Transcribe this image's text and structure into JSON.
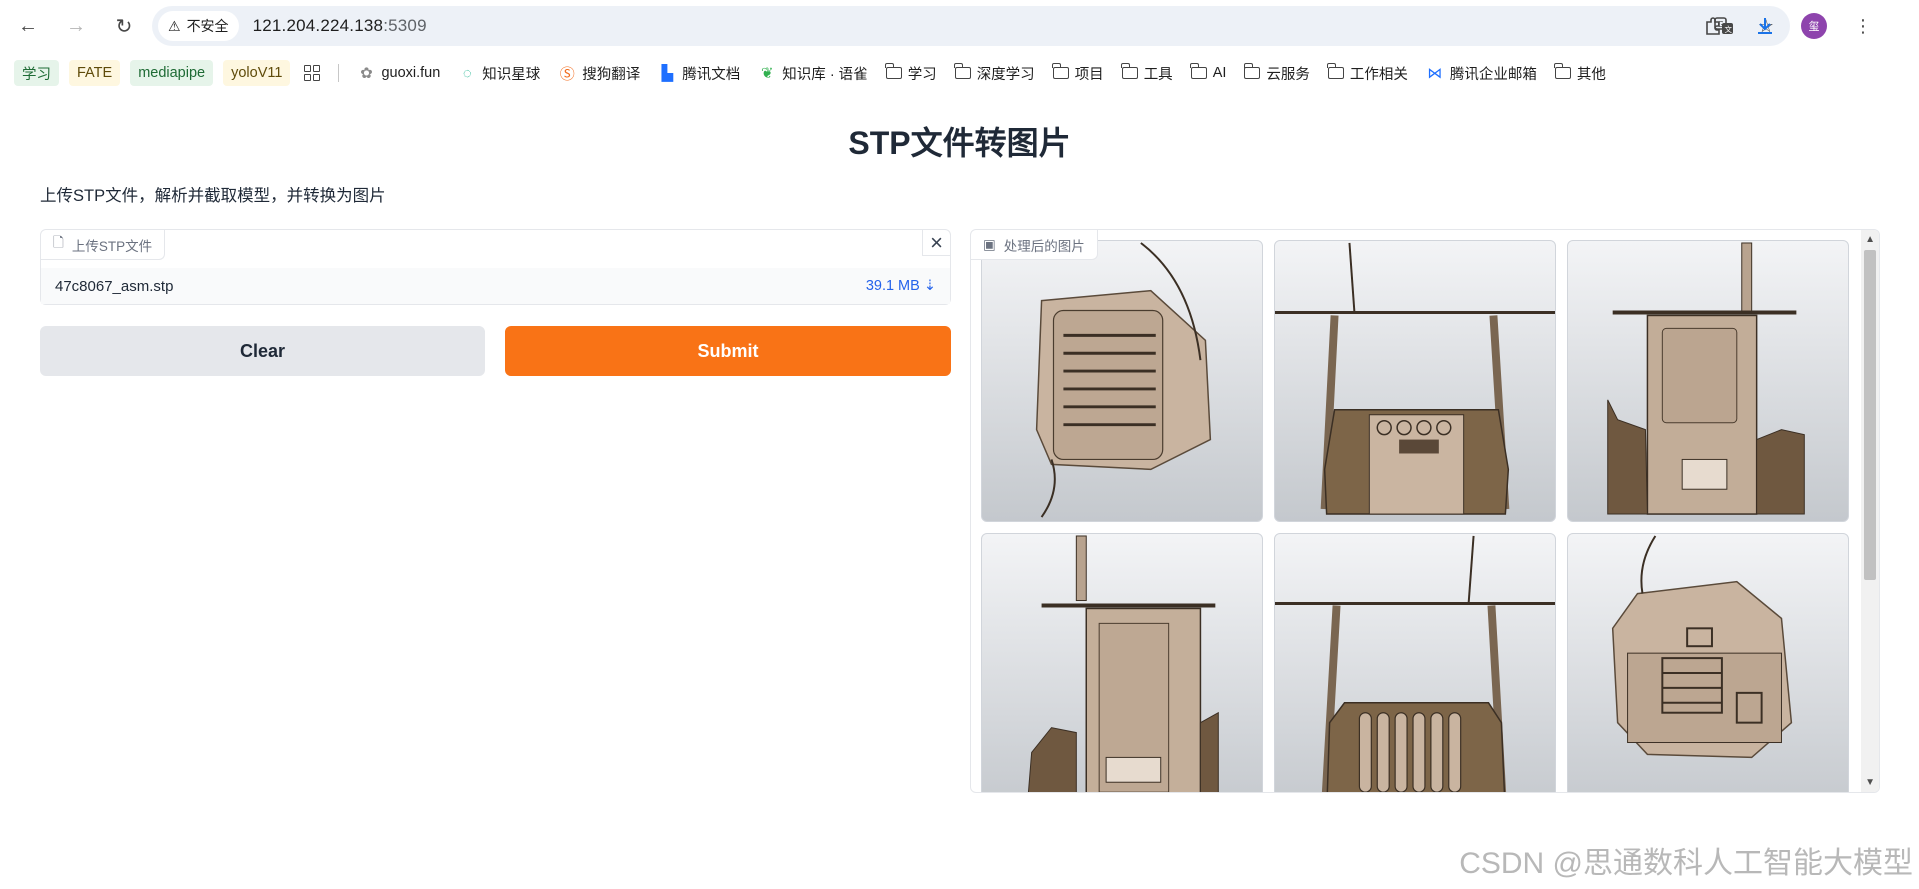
{
  "browser": {
    "security_label": "不安全",
    "url_host": "121.204.224.138",
    "url_port": ":5309",
    "avatar_text": "玺"
  },
  "bookmarks": [
    {
      "label": "学习",
      "style": "tag-green"
    },
    {
      "label": "FATE",
      "style": "tag-yellow"
    },
    {
      "label": "mediapipe",
      "style": "tag-green"
    },
    {
      "label": "yoloV11",
      "style": "tag-yellow"
    },
    {
      "label": "guoxi.fun",
      "icon": "globe"
    },
    {
      "label": "知识星球",
      "icon": "planet"
    },
    {
      "label": "搜狗翻译",
      "icon": "sogou"
    },
    {
      "label": "腾讯文档",
      "icon": "tencent-docs"
    },
    {
      "label": "知识库 · 语雀",
      "icon": "yuque"
    },
    {
      "label": "学习",
      "icon": "folder"
    },
    {
      "label": "深度学习",
      "icon": "folder"
    },
    {
      "label": "项目",
      "icon": "folder"
    },
    {
      "label": "工具",
      "icon": "folder"
    },
    {
      "label": "AI",
      "icon": "folder"
    },
    {
      "label": "云服务",
      "icon": "folder"
    },
    {
      "label": "工作相关",
      "icon": "folder"
    },
    {
      "label": "腾讯企业邮箱",
      "icon": "tencent-mail"
    },
    {
      "label": "其他",
      "icon": "folder"
    }
  ],
  "page": {
    "title": "STP文件转图片",
    "description": "上传STP文件，解析并截取模型，并转换为图片"
  },
  "upload": {
    "label": "上传STP文件",
    "file_name": "47c8067_asm.stp",
    "file_size": "39.1 MB ⇣"
  },
  "buttons": {
    "clear": "Clear",
    "submit": "Submit"
  },
  "gallery": {
    "label": "处理后的图片"
  },
  "watermark": "CSDN @思通数科人工智能大模型",
  "colors": {
    "accent": "#f97316",
    "link": "#2563eb",
    "model_fill": "#b8a38f",
    "model_dark": "#6e5a43"
  }
}
